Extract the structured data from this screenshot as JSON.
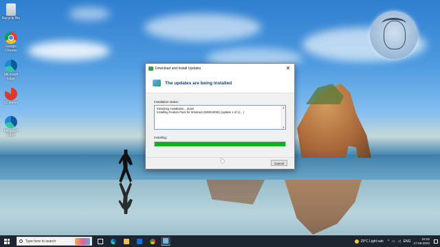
{
  "desktop": {
    "icons": [
      {
        "label": "Recycle Bin",
        "icon": "recycle-bin-icon"
      },
      {
        "label": "Google Chrome",
        "icon": "chrome-icon"
      },
      {
        "label": "Microsoft Edge",
        "icon": "edge-icon"
      },
      {
        "label": "CCleaner",
        "icon": "ccleaner-icon"
      },
      {
        "label": "Microsoft Edge",
        "icon": "edge-icon"
      }
    ]
  },
  "dialog": {
    "title": "Download and Install Updates",
    "close_glyph": "✕",
    "heading": "The updates are being installed",
    "status_label": "Installation status:",
    "status_lines": [
      "Initializing installation... done!",
      "Installing Feature Pack for Windows (KB3010081) (update 1 of 1)... |"
    ],
    "installing_label": "Installing:",
    "progress_percent": 100,
    "cancel_label": "Cancel"
  },
  "taskbar": {
    "search_placeholder": "Type here to search",
    "apps": [
      "task-view-icon",
      "edge-icon",
      "file-explorer-icon",
      "mail-icon",
      "chrome-icon",
      "update-installer-icon"
    ],
    "weather": "29°C  Light rain",
    "language": "ENG",
    "time": "22:02",
    "date": "17-09-2022"
  },
  "colors": {
    "progress_fill": "#06b025",
    "taskbar_bg": "#1c2530",
    "heading_text": "#1a3a6a"
  }
}
